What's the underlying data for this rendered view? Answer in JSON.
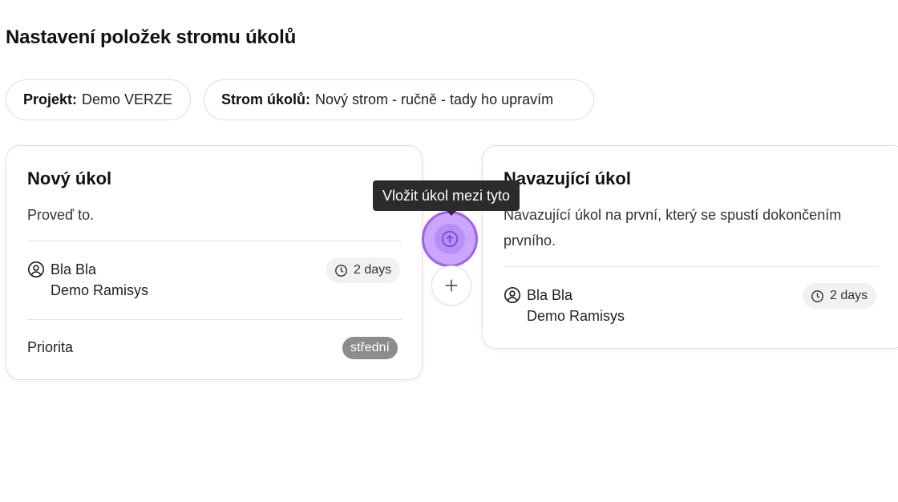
{
  "page": {
    "title": "Nastavení položek stromu úkolů"
  },
  "filters": {
    "project": {
      "label": "Projekt:",
      "value": "Demo VERZE"
    },
    "tree": {
      "label": "Strom úkolů:",
      "value": "Nový strom - ručně - tady ho upravím"
    }
  },
  "cards": [
    {
      "title": "Nový úkol",
      "description": "Proveď to.",
      "assignee": {
        "name": "Bla Bla",
        "org": "Demo Ramisys",
        "icon": "user-circle-icon"
      },
      "duration": {
        "value": "2 days",
        "icon": "clock-icon"
      },
      "priority": {
        "label": "Priorita",
        "value": "střední"
      }
    },
    {
      "title": "Navazující úkol",
      "description": "Navazující úkol na první, který se spustí dokončením prvního.",
      "assignee": {
        "name": "Bla Bla",
        "org": "Demo Ramisys",
        "icon": "user-circle-icon"
      },
      "duration": {
        "value": "2 days",
        "icon": "clock-icon"
      }
    }
  ],
  "connector": {
    "tooltip": "Vložit úkol mezi tyto",
    "insert_icon": "arrow-up-circle-icon",
    "add_icon": "plus-icon"
  },
  "colors": {
    "accent_fill": "#c9a6ff",
    "accent_border": "#9f5ef5",
    "badge_bg": "#8c8c8c",
    "tooltip_bg": "#2b2b2b"
  }
}
